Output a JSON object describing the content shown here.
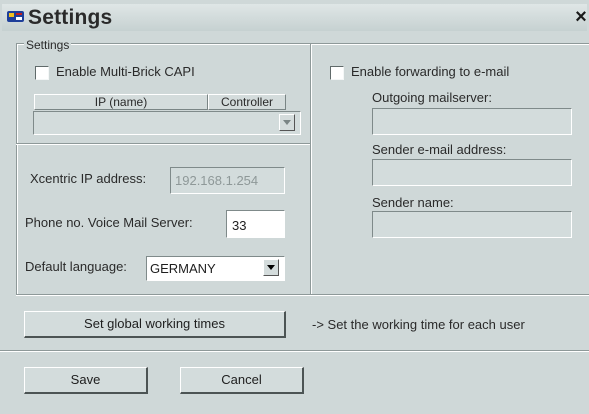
{
  "window": {
    "title": "Settings",
    "close_glyph": "×",
    "icon": "settings-app-icon"
  },
  "settings_group": {
    "label": "Settings"
  },
  "multi_brick": {
    "checkbox_label": "Enable Multi-Brick CAPI",
    "checked": false,
    "columns": [
      "IP (name)",
      "Controller"
    ]
  },
  "xcentric": {
    "label": "Xcentric IP address:",
    "value": "192.168.1.254"
  },
  "phone": {
    "label": "Phone no. Voice Mail Server:",
    "value": "33"
  },
  "language": {
    "label": "Default language:",
    "value": "GERMANY"
  },
  "email": {
    "checkbox_label": "Enable forwarding to e-mail",
    "checked": false,
    "outgoing_label": "Outgoing mailserver:",
    "outgoing_value": "",
    "sender_address_label": "Sender e-mail address:",
    "sender_address_value": "",
    "sender_name_label": "Sender name:",
    "sender_name_value": ""
  },
  "working_times": {
    "button_label": "Set global working times",
    "hint": "-> Set the working time for each user"
  },
  "footer": {
    "save_label": "Save",
    "cancel_label": "Cancel"
  },
  "colors": {
    "dialog_bg": "#cfd8d8",
    "title_text": "#2a2a2a"
  }
}
